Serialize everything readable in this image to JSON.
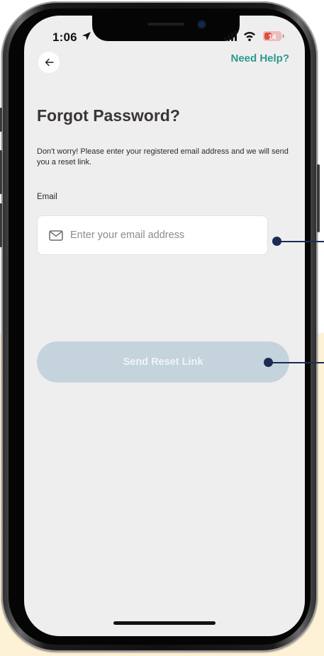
{
  "status_bar": {
    "time": "1:06",
    "battery": "14"
  },
  "header": {
    "back_icon": "arrow-left-icon",
    "help_link": "Need Help?"
  },
  "page": {
    "title": "Forgot Password?",
    "description": "Don't worry! Please enter your registered email address and we will send you a reset link."
  },
  "email": {
    "label": "Email",
    "placeholder": "Enter your email address",
    "icon": "mail-icon",
    "value": ""
  },
  "actions": {
    "send_label": "Send Reset Link"
  },
  "colors": {
    "accent": "#2d9a8e",
    "screen_bg": "#efeeef",
    "button_disabled": "#c5d3dd",
    "callout": "#1c2a55",
    "background_band": "#fdf1d6"
  }
}
